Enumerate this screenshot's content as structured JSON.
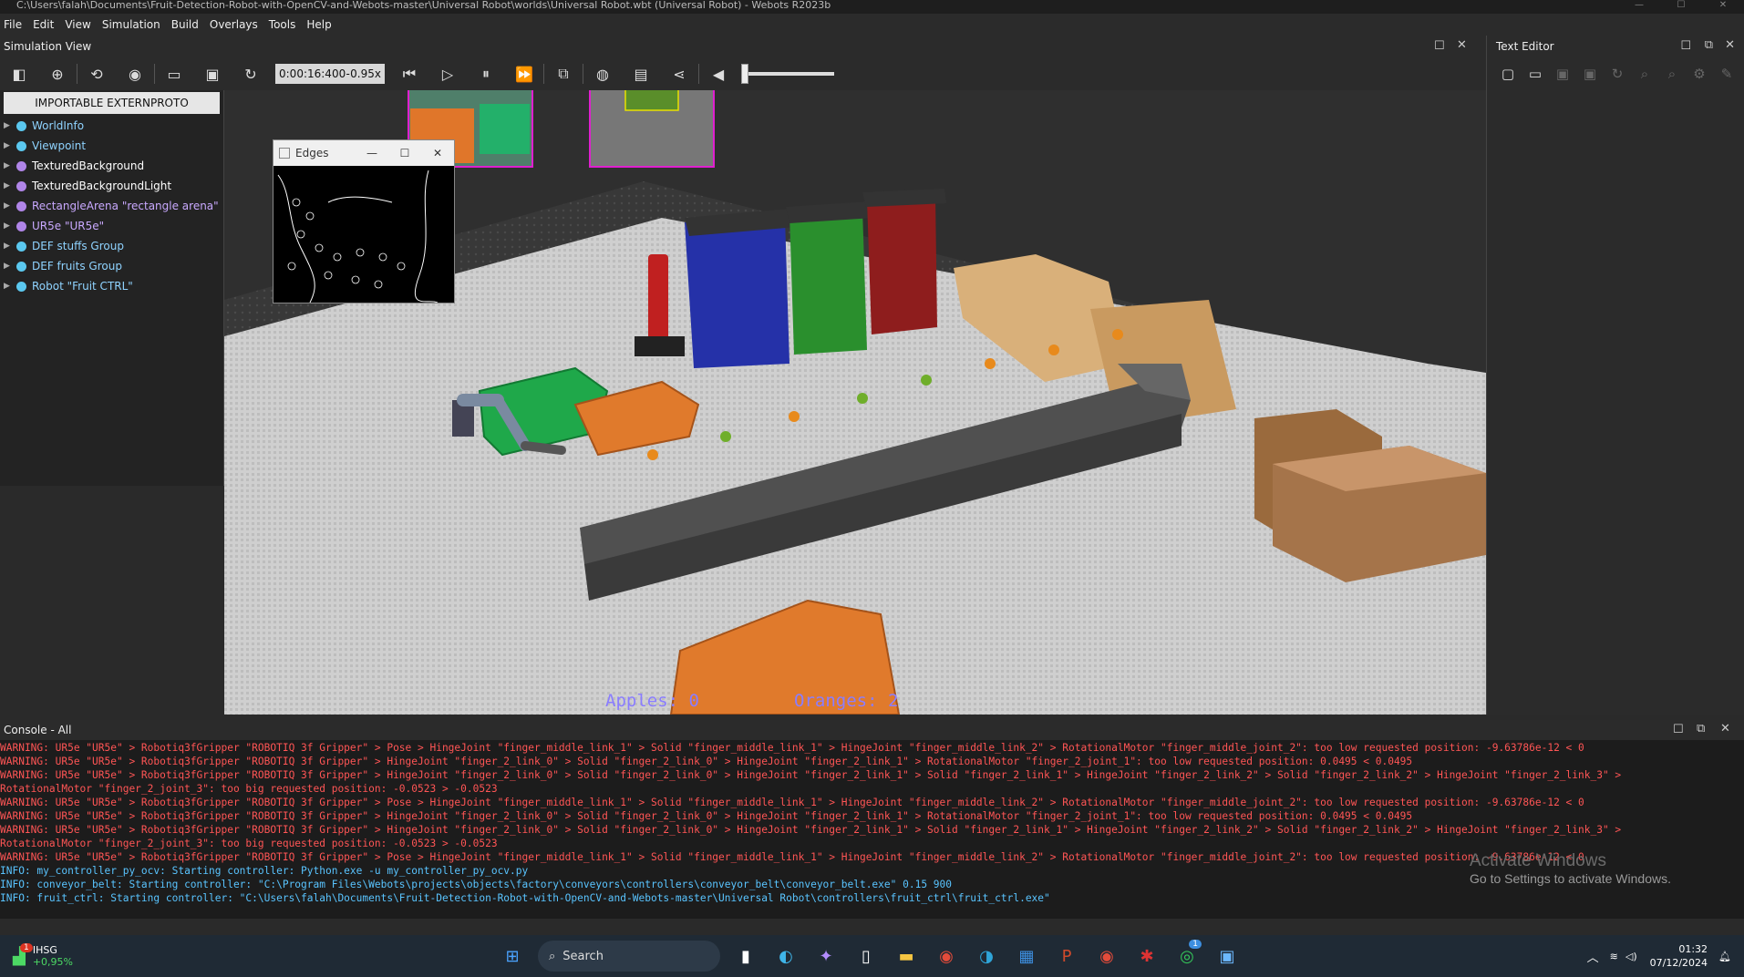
{
  "window": {
    "title": "C:\\Users\\falah\\Documents\\Fruit-Detection-Robot-with-OpenCV-and-Webots-master\\Universal Robot\\worlds\\Universal Robot.wbt (Universal Robot) - Webots R2023b",
    "minimize": "—",
    "maximize": "☐",
    "close": "✕"
  },
  "menu": [
    "File",
    "Edit",
    "View",
    "Simulation",
    "Build",
    "Overlays",
    "Tools",
    "Help"
  ],
  "simulation_view": {
    "title": "Simulation View",
    "time": "0:00:16:400",
    "time_sep": "-",
    "speed": "0.95x",
    "speed_slider_fraction": 0.0
  },
  "scene_tree": {
    "button": "IMPORTABLE EXTERNPROTO",
    "items": [
      {
        "label": "WorldInfo",
        "dot": "#5bc8ef",
        "color": "#8fd3ff"
      },
      {
        "label": "Viewpoint",
        "dot": "#5bc8ef",
        "color": "#8fd3ff"
      },
      {
        "label": "TexturedBackground",
        "dot": "#b085e8",
        "color": "#ffffff"
      },
      {
        "label": "TexturedBackgroundLight",
        "dot": "#b085e8",
        "color": "#ffffff"
      },
      {
        "label": "RectangleArena \"rectangle arena\"",
        "dot": "#b085e8",
        "color": "#c9a9ff"
      },
      {
        "label": "UR5e \"UR5e\"",
        "dot": "#b085e8",
        "color": "#c9a9ff"
      },
      {
        "label": "DEF stuffs Group",
        "dot": "#5bc8ef",
        "color": "#8fd3ff"
      },
      {
        "label": "DEF fruits Group",
        "dot": "#5bc8ef",
        "color": "#8fd3ff"
      },
      {
        "label": "Robot \"Fruit CTRL\"",
        "dot": "#5bc8ef",
        "color": "#8fd3ff"
      }
    ]
  },
  "edges_window": {
    "title": "Edges",
    "minimize": "—",
    "maximize": "☐",
    "close": "✕"
  },
  "viewport": {
    "counter_apples": "Apples: 0",
    "counter_oranges": "Oranges: 2"
  },
  "text_editor": {
    "title": "Text Editor"
  },
  "console": {
    "title": "Console - All",
    "lines": [
      {
        "type": "warn",
        "text": "WARNING: UR5e \"UR5e\" > Robotiq3fGripper \"ROBOTIQ 3f Gripper\" > Pose  > HingeJoint \"finger_middle_link_1\" > Solid \"finger_middle_link_1\" > HingeJoint \"finger_middle_link_2\" > RotationalMotor \"finger_middle_joint_2\": too low requested position: -9.63786e-12 < 0"
      },
      {
        "type": "warn",
        "text": "WARNING: UR5e \"UR5e\" > Robotiq3fGripper \"ROBOTIQ 3f Gripper\" > HingeJoint \"finger_2_link_0\" > Solid \"finger_2_link_0\" > HingeJoint \"finger_2_link_1\" > RotationalMotor \"finger_2_joint_1\": too low requested position: 0.0495 < 0.0495"
      },
      {
        "type": "warn",
        "text": "WARNING: UR5e \"UR5e\" > Robotiq3fGripper \"ROBOTIQ 3f Gripper\" > HingeJoint \"finger_2_link_0\" > Solid \"finger_2_link_0\" > HingeJoint \"finger_2_link_1\" > Solid \"finger_2_link_1\" > HingeJoint \"finger_2_link_2\" > Solid \"finger_2_link_2\" > HingeJoint \"finger_2_link_3\" >"
      },
      {
        "type": "warn",
        "text": "RotationalMotor \"finger_2_joint_3\": too big requested position: -0.0523 > -0.0523"
      },
      {
        "type": "warn",
        "text": "WARNING: UR5e \"UR5e\" > Robotiq3fGripper \"ROBOTIQ 3f Gripper\" > Pose  > HingeJoint \"finger_middle_link_1\" > Solid \"finger_middle_link_1\" > HingeJoint \"finger_middle_link_2\" > RotationalMotor \"finger_middle_joint_2\": too low requested position: -9.63786e-12 < 0"
      },
      {
        "type": "warn",
        "text": "WARNING: UR5e \"UR5e\" > Robotiq3fGripper \"ROBOTIQ 3f Gripper\" > HingeJoint \"finger_2_link_0\" > Solid \"finger_2_link_0\" > HingeJoint \"finger_2_link_1\" > RotationalMotor \"finger_2_joint_1\": too low requested position: 0.0495 < 0.0495"
      },
      {
        "type": "warn",
        "text": "WARNING: UR5e \"UR5e\" > Robotiq3fGripper \"ROBOTIQ 3f Gripper\" > HingeJoint \"finger_2_link_0\" > Solid \"finger_2_link_0\" > HingeJoint \"finger_2_link_1\" > Solid \"finger_2_link_1\" > HingeJoint \"finger_2_link_2\" > Solid \"finger_2_link_2\" > HingeJoint \"finger_2_link_3\" >"
      },
      {
        "type": "warn",
        "text": "RotationalMotor \"finger_2_joint_3\": too big requested position: -0.0523 > -0.0523"
      },
      {
        "type": "warn",
        "text": "WARNING: UR5e \"UR5e\" > Robotiq3fGripper \"ROBOTIQ 3f Gripper\" > Pose  > HingeJoint \"finger_middle_link_1\" > Solid \"finger_middle_link_1\" > HingeJoint \"finger_middle_link_2\" > RotationalMotor \"finger_middle_joint_2\": too low requested position: -9.63786e-12 < 0"
      },
      {
        "type": "info",
        "text": "INFO: my_controller_py_ocv: Starting controller: Python.exe -u my_controller_py_ocv.py"
      },
      {
        "type": "info",
        "text": "INFO: conveyor_belt: Starting controller: \"C:\\Program Files\\Webots\\projects\\objects\\factory\\conveyors\\controllers\\conveyor_belt\\conveyor_belt.exe\" 0.15 900"
      },
      {
        "type": "info",
        "text": "INFO: fruit_ctrl: Starting controller: \"C:\\Users\\falah\\Documents\\Fruit-Detection-Robot-with-OpenCV-and-Webots-master\\Universal Robot\\controllers\\fruit_ctrl\\fruit_ctrl.exe\""
      }
    ]
  },
  "watermark": {
    "line1": "Activate Windows",
    "line2": "Go to Settings to activate Windows."
  },
  "taskbar": {
    "stock_name": "IHSG",
    "stock_change": "+0,95%",
    "stock_badge": "1",
    "search_placeholder": "Search",
    "whatsapp_badge": "1",
    "time": "01:32",
    "date": "07/12/2024"
  }
}
